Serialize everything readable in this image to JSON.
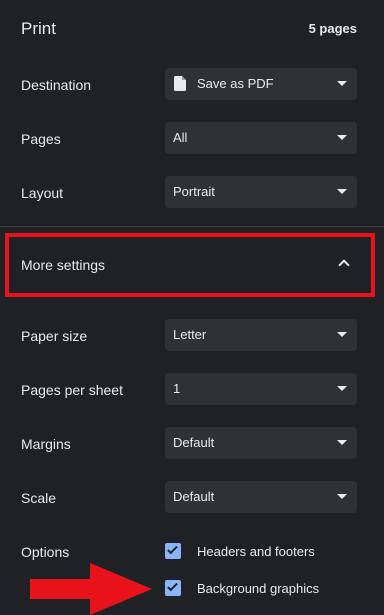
{
  "header": {
    "title": "Print",
    "pages_count": "5 pages"
  },
  "settings": {
    "destination": {
      "label": "Destination",
      "value": "Save as PDF",
      "icon": "file-icon"
    },
    "pages": {
      "label": "Pages",
      "value": "All"
    },
    "layout": {
      "label": "Layout",
      "value": "Portrait"
    }
  },
  "more_settings": {
    "label": "More settings",
    "expanded": true
  },
  "advanced": {
    "paper_size": {
      "label": "Paper size",
      "value": "Letter"
    },
    "pages_per_sheet": {
      "label": "Pages per sheet",
      "value": "1"
    },
    "margins": {
      "label": "Margins",
      "value": "Default"
    },
    "scale": {
      "label": "Scale",
      "value": "Default"
    },
    "options": {
      "label": "Options",
      "items": [
        {
          "label": "Headers and footers",
          "checked": true
        },
        {
          "label": "Background graphics",
          "checked": true
        }
      ]
    }
  },
  "colors": {
    "background": "#202124",
    "field": "#303134",
    "accent": "#8ab4f8",
    "annotation": "#e8131a"
  }
}
